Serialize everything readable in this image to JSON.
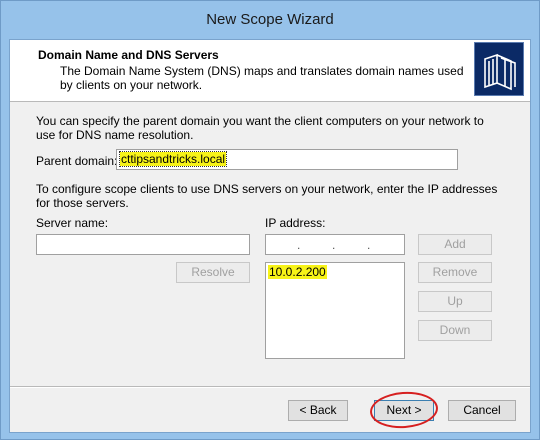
{
  "window": {
    "title": "New Scope Wizard"
  },
  "header": {
    "title": "Domain Name and DNS Servers",
    "description": "The Domain Name System (DNS) maps and translates domain names used by clients on your network.",
    "icon": "books-icon"
  },
  "intro_text": "You can specify the parent domain you want the client computers on your network to use for DNS name resolution.",
  "parent_domain": {
    "label": "Parent domain:",
    "value": "cttipsandtricks.local"
  },
  "dns_text": "To configure scope clients to use DNS servers on your network, enter the IP addresses for those servers.",
  "server_name": {
    "label": "Server name:",
    "value": ""
  },
  "ip_address": {
    "label": "IP address:",
    "value": ". . ."
  },
  "ip_list": [
    "10.0.2.200"
  ],
  "buttons": {
    "resolve": "Resolve",
    "add": "Add",
    "remove": "Remove",
    "up": "Up",
    "down": "Down",
    "back": "< Back",
    "next": "Next >",
    "cancel": "Cancel"
  },
  "colors": {
    "highlight": "#f7f318",
    "annotation": "#d62020",
    "titlebar": "#96c2ea"
  }
}
